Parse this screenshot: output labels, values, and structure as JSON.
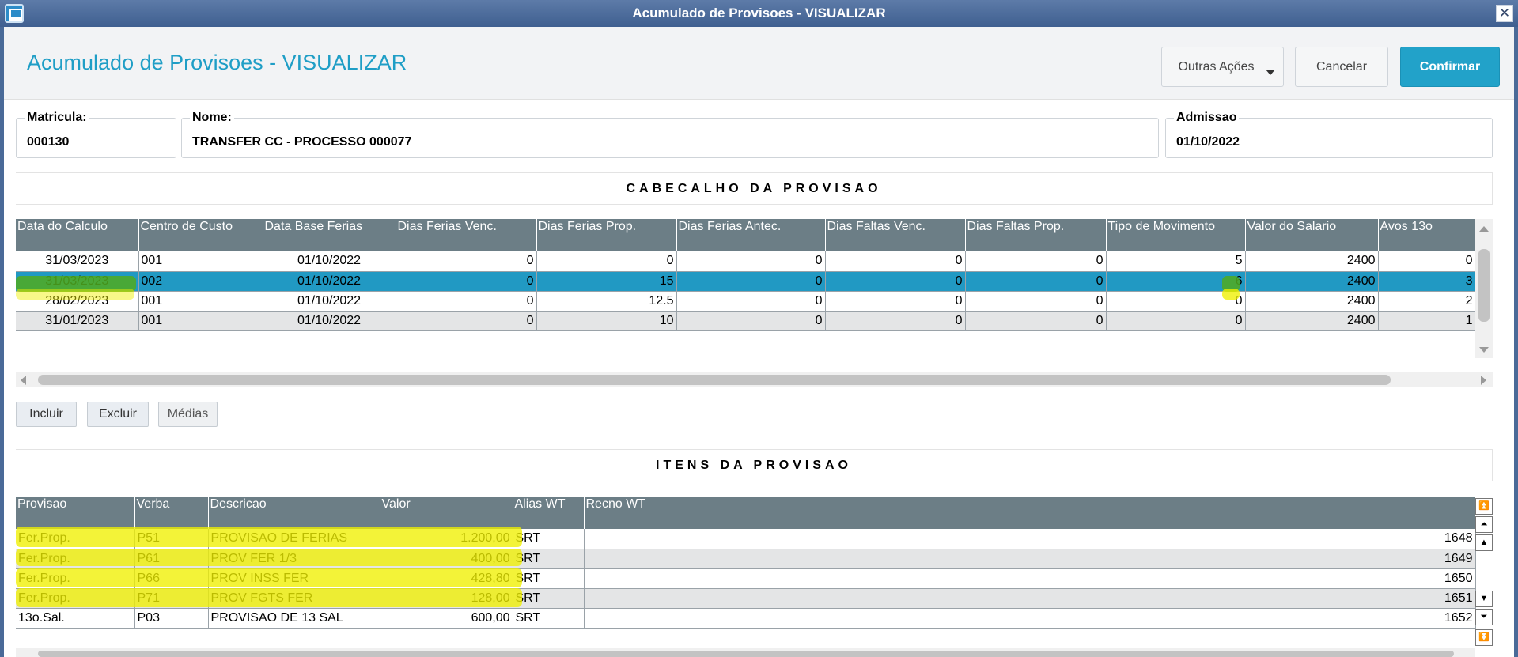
{
  "window": {
    "title": "Acumulado de Provisoes - VISUALIZAR"
  },
  "header": {
    "title": "Acumulado de Provisoes - VISUALIZAR",
    "outras_acoes_label": "Outras Ações",
    "cancelar_label": "Cancelar",
    "confirmar_label": "Confirmar"
  },
  "fields": {
    "matricula": {
      "label": "Matricula:",
      "value": "000130"
    },
    "nome": {
      "label": "Nome:",
      "value": "TRANSFER CC - PROCESSO 000077"
    },
    "admissao": {
      "label": "Admissao",
      "value": "01/10/2022"
    }
  },
  "cabecalho": {
    "title": "CABECALHO DA PROVISAO",
    "columns": [
      "Data do Calculo",
      "Centro de Custo",
      "Data Base Ferias",
      "Dias Ferias Venc.",
      "Dias Ferias Prop.",
      "Dias Ferias Antec.",
      "Dias Faltas Venc.",
      "Dias Faltas Prop.",
      "Tipo de Movimento",
      "Valor do Salario",
      "Avos 13o"
    ],
    "rows": [
      [
        "31/03/2023",
        "001",
        "01/10/2022",
        "0",
        "0",
        "0",
        "0",
        "0",
        "5",
        "2400",
        "0"
      ],
      [
        "31/03/2023",
        "002",
        "01/10/2022",
        "0",
        "15",
        "0",
        "0",
        "0",
        "6",
        "2400",
        "3"
      ],
      [
        "28/02/2023",
        "001",
        "01/10/2022",
        "0",
        "12.5",
        "0",
        "0",
        "0",
        "0",
        "2400",
        "2"
      ],
      [
        "31/01/2023",
        "001",
        "01/10/2022",
        "0",
        "10",
        "0",
        "0",
        "0",
        "0",
        "2400",
        "1"
      ]
    ]
  },
  "actions": {
    "incluir": "Incluir",
    "excluir": "Excluir",
    "medias": "Médias"
  },
  "itens": {
    "title": "ITENS DA PROVISAO",
    "columns": [
      "Provisao",
      "Verba",
      "Descricao",
      "Valor",
      "Alias WT",
      "Recno WT"
    ],
    "rows": [
      [
        "Fer.Prop.",
        "P51",
        "PROVISAO DE FERIAS",
        "1.200,00",
        "SRT",
        "1648"
      ],
      [
        "Fer.Prop.",
        "P61",
        "PROV FER 1/3",
        "400,00",
        "SRT",
        "1649"
      ],
      [
        "Fer.Prop.",
        "P66",
        "PROV INSS FER",
        "428,80",
        "SRT",
        "1650"
      ],
      [
        "Fer.Prop.",
        "P71",
        "PROV FGTS FER",
        "128,00",
        "SRT",
        "1651"
      ],
      [
        "13o.Sal.",
        "P03",
        "PROVISAO DE 13 SAL",
        "600,00",
        "SRT",
        "1652"
      ]
    ]
  }
}
